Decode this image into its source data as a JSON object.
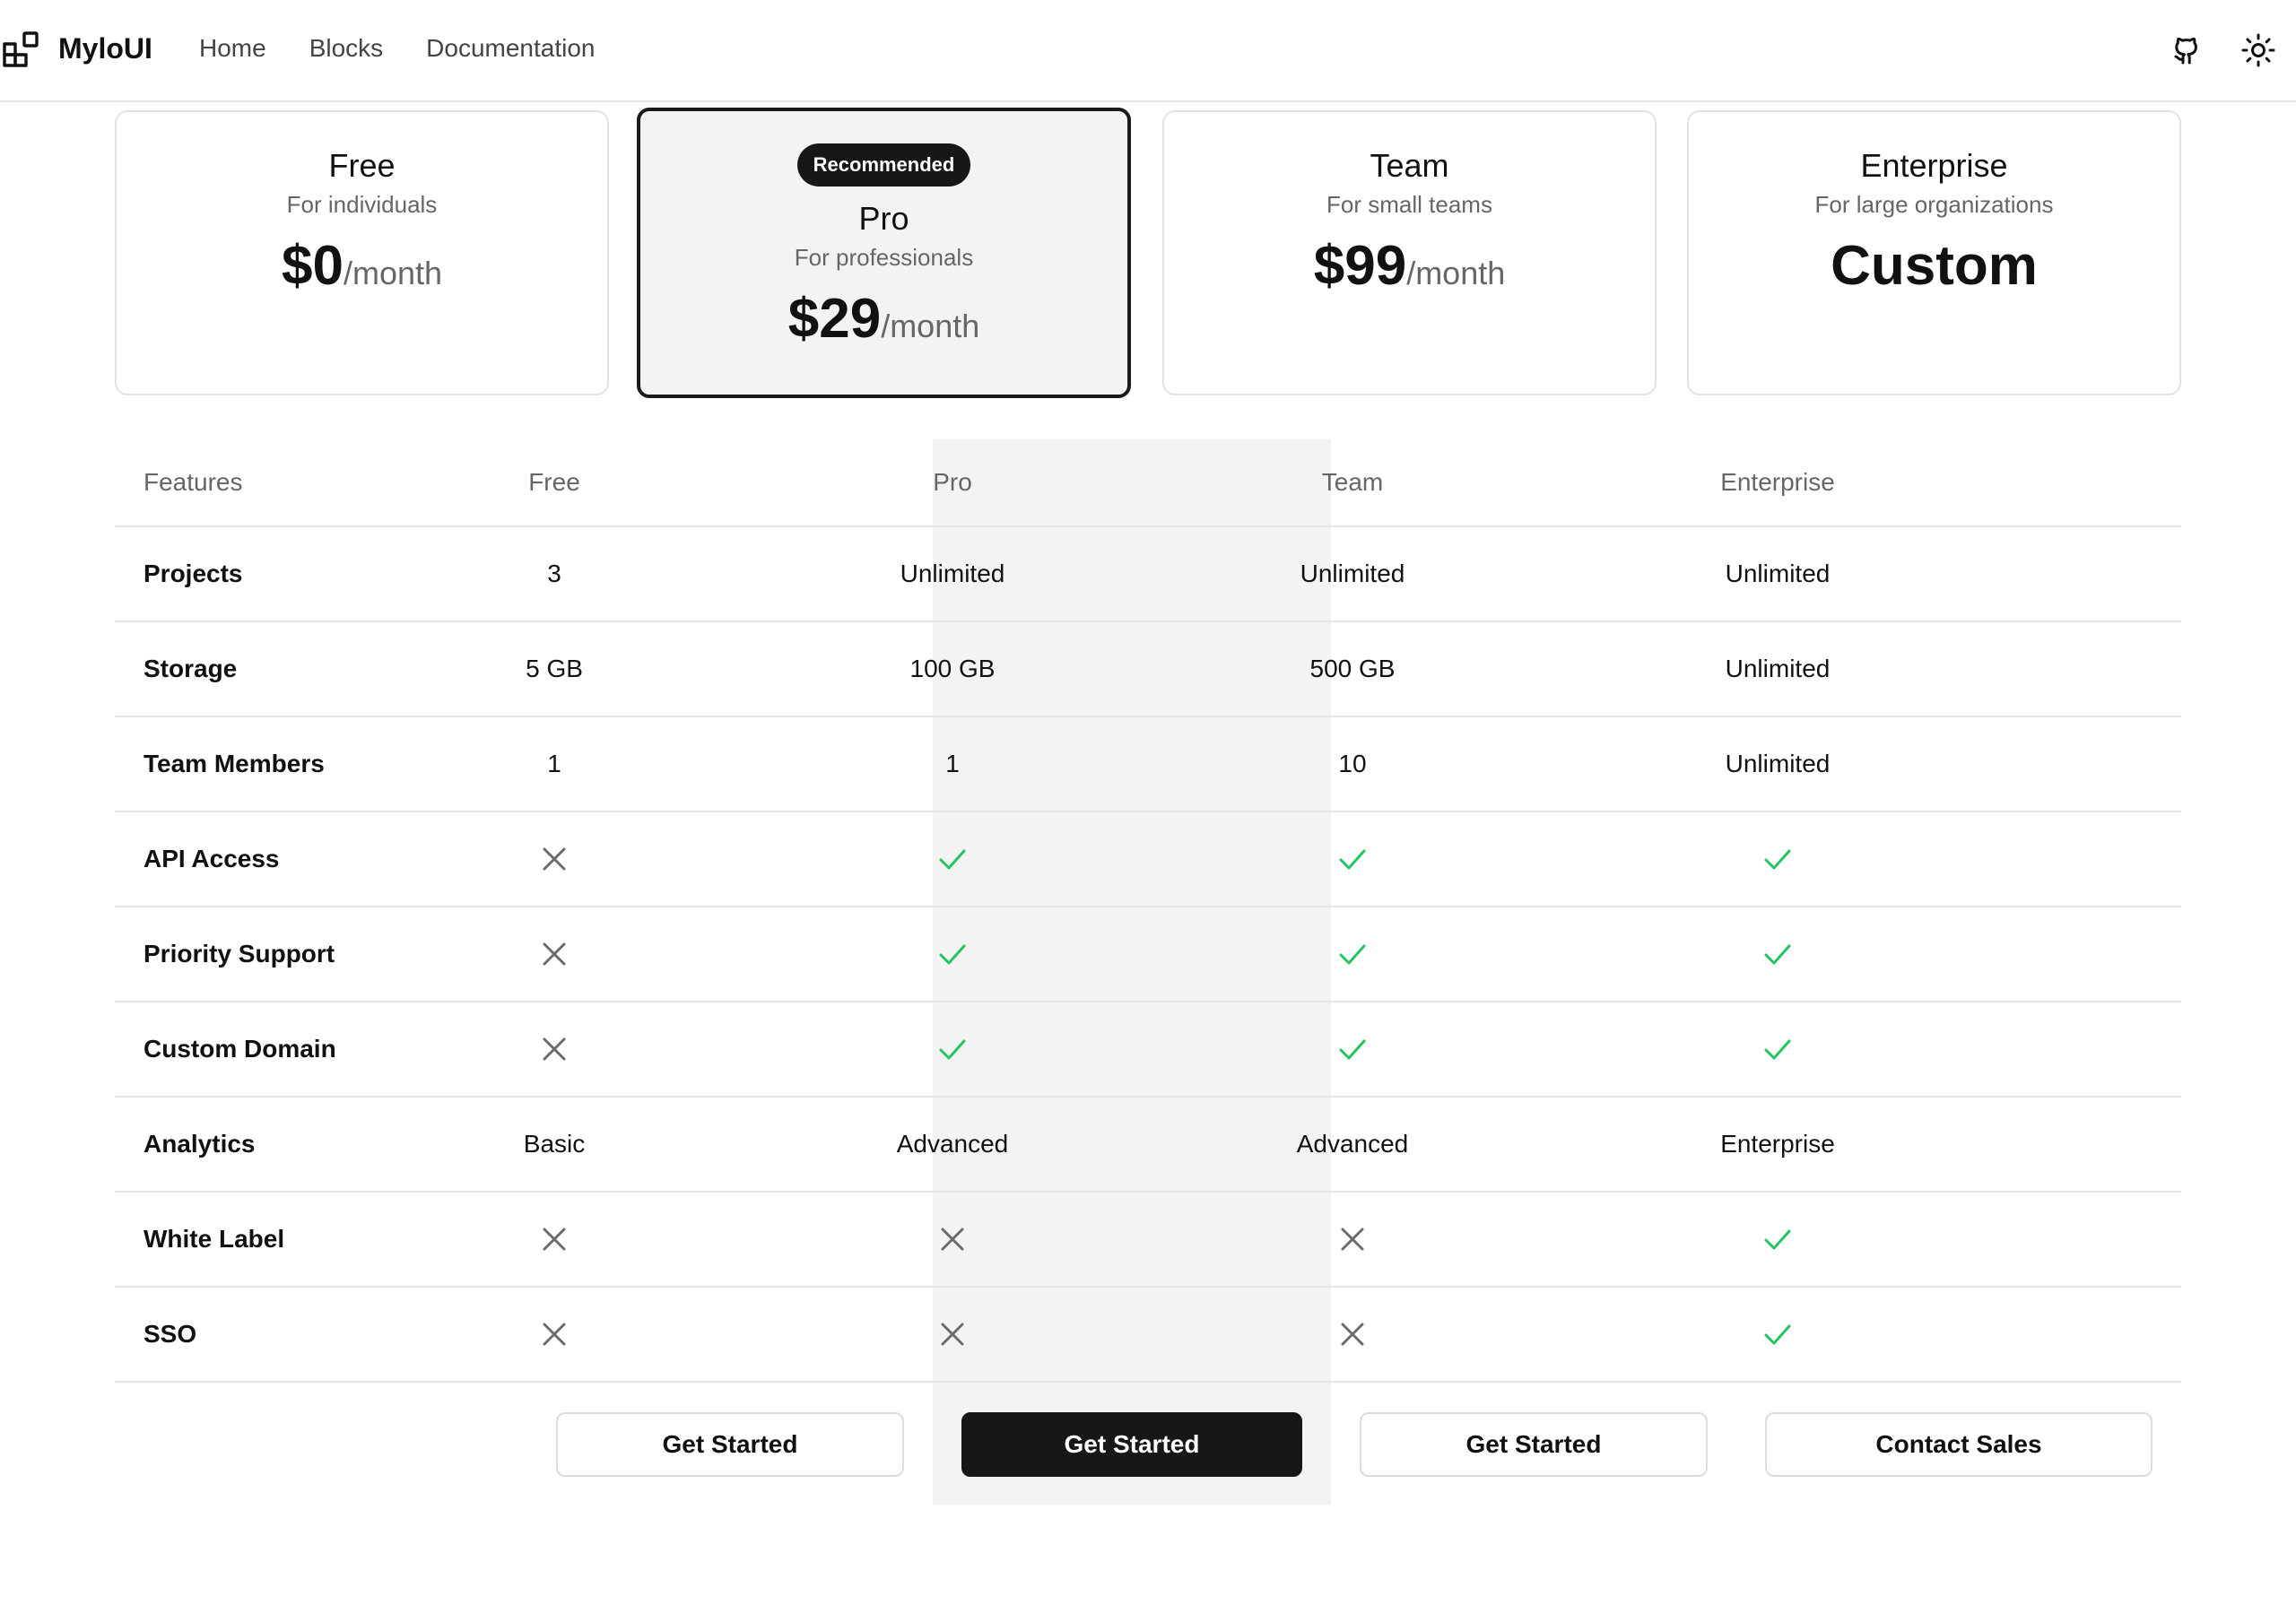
{
  "header": {
    "brand": "MyloUI",
    "nav": [
      "Home",
      "Blocks",
      "Documentation"
    ],
    "icons": [
      "github-icon",
      "sun-icon"
    ]
  },
  "plans": [
    {
      "name": "Free",
      "description": "For individuals",
      "price": "$0",
      "period": "/month"
    },
    {
      "name": "Pro",
      "badge": "Recommended",
      "description": "For professionals",
      "price": "$29",
      "period": "/month"
    },
    {
      "name": "Team",
      "description": "For small teams",
      "price": "$99",
      "period": "/month"
    },
    {
      "name": "Enterprise",
      "description": "For large organizations",
      "price": "Custom",
      "period": ""
    }
  ],
  "table": {
    "headers": [
      "Features",
      "Free",
      "Pro",
      "Team",
      "Enterprise"
    ],
    "rows": [
      {
        "feature": "Projects",
        "values": [
          "3",
          "Unlimited",
          "Unlimited",
          "Unlimited"
        ]
      },
      {
        "feature": "Storage",
        "values": [
          "5 GB",
          "100 GB",
          "500 GB",
          "Unlimited"
        ]
      },
      {
        "feature": "Team Members",
        "values": [
          "1",
          "1",
          "10",
          "Unlimited"
        ]
      },
      {
        "feature": "API Access",
        "values": [
          false,
          true,
          true,
          true
        ]
      },
      {
        "feature": "Priority Support",
        "values": [
          false,
          true,
          true,
          true
        ]
      },
      {
        "feature": "Custom Domain",
        "values": [
          false,
          true,
          true,
          true
        ]
      },
      {
        "feature": "Analytics",
        "values": [
          "Basic",
          "Advanced",
          "Advanced",
          "Enterprise"
        ]
      },
      {
        "feature": "White Label",
        "values": [
          false,
          false,
          false,
          true
        ]
      },
      {
        "feature": "SSO",
        "values": [
          false,
          false,
          false,
          true
        ]
      }
    ]
  },
  "buttons": [
    "Get Started",
    "Get Started",
    "Get Started",
    "Contact Sales"
  ],
  "colors": {
    "check": "#22c55e",
    "cross": "#6b6b6b",
    "highlight_bg": "#f3f3f3",
    "primary_button": "#171717"
  }
}
